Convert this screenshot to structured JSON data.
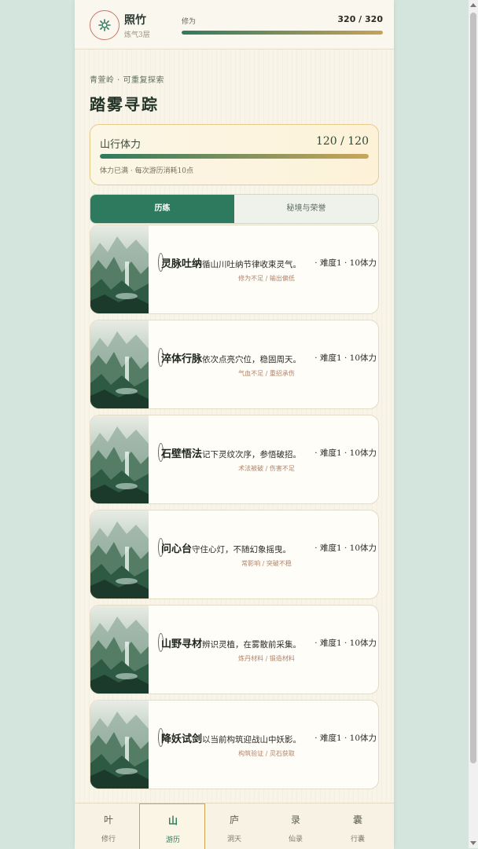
{
  "header": {
    "name": "照竹",
    "realm": "炼气3层",
    "xp_label": "修为",
    "xp_value": "320 / 320",
    "xp_progress": 1.0
  },
  "page": {
    "breadcrumb": "青萱岭 · 可重复探索",
    "title": "踏雾寻踪"
  },
  "stamina": {
    "label": "山行体力",
    "value": "120 / 120",
    "progress": 1.0,
    "note": "体力已满 · 每次游历消耗10点"
  },
  "tabs": [
    {
      "label": "历练",
      "active": true
    },
    {
      "label": "秘境与荣誉",
      "active": false
    }
  ],
  "cards": [
    {
      "title": "灵脉吐纳",
      "desc": "循山川吐纳节律收束灵气。",
      "meta": "· 难度1 · 10体力",
      "tags": "修为不足 / 输出偏低"
    },
    {
      "title": "淬体行脉",
      "desc": "依次点亮穴位，稳固周天。",
      "meta": "· 难度1 · 10体力",
      "tags": "气血不足 / 重招承伤"
    },
    {
      "title": "石壁悟法",
      "desc": "记下灵纹次序，参悟破招。",
      "meta": "· 难度1 · 10体力",
      "tags": "术法被破 / 伤害不足"
    },
    {
      "title": "问心台",
      "desc": "守住心灯，不随幻象摇曳。",
      "meta": "· 难度1 · 10体力",
      "tags": "常影响 / 突破不稳"
    },
    {
      "title": "山野寻材",
      "desc": "辨识灵植，在雾散前采集。",
      "meta": "· 难度1 · 10体力",
      "tags": "炼丹材料 / 锻造材料"
    },
    {
      "title": "降妖试剑",
      "desc": "以当前构筑迎战山中妖影。",
      "meta": "· 难度1 · 10体力",
      "tags": "构筑验证 / 灵石获取"
    }
  ],
  "nav": [
    {
      "glyph": "叶",
      "label": "修行",
      "active": false
    },
    {
      "glyph": "山",
      "label": "游历",
      "active": true
    },
    {
      "glyph": "庐",
      "label": "洞天",
      "active": false
    },
    {
      "glyph": "录",
      "label": "仙录",
      "active": false
    },
    {
      "glyph": "囊",
      "label": "行囊",
      "active": false
    }
  ],
  "colors": {
    "accent": "#2e7a5f",
    "gold": "#c9a65a",
    "background": "#d3e5dc"
  },
  "icons": {
    "avatar": "gear-icon"
  }
}
